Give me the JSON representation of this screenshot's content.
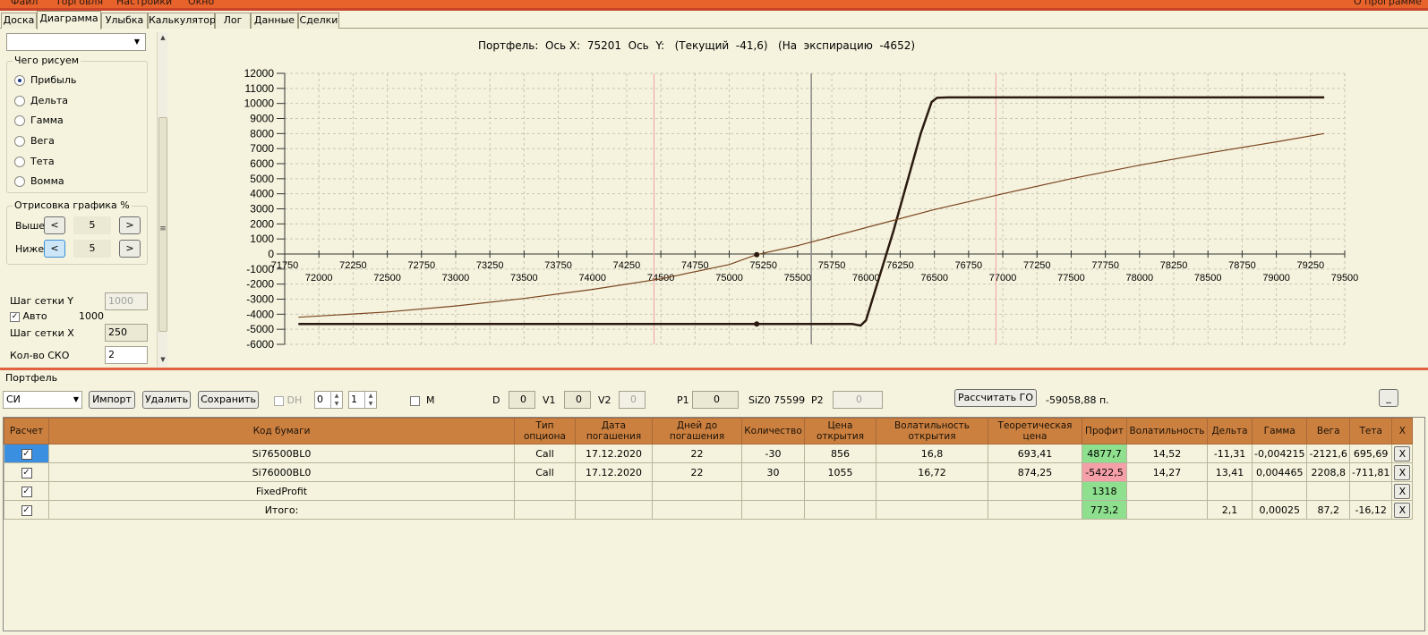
{
  "menubar": {
    "items": [
      "Файл",
      "Торговля",
      "Настройки",
      "Окно"
    ],
    "about": "О программе"
  },
  "tabs": [
    "Доска",
    "Диаграмма",
    "Улыбка",
    "Калькулятор",
    "Лог",
    "Данные",
    "Сделки"
  ],
  "active_tab": "Диаграмма",
  "left": {
    "combo_value": "",
    "what_group": "Чего рисуем",
    "radios": [
      "Прибыль",
      "Дельта",
      "Гамма",
      "Вега",
      "Тета",
      "Вомма"
    ],
    "radio_selected": "Прибыль",
    "draw_group": "Отрисовка графика %",
    "above_label": "Выше",
    "above_value": "5",
    "below_label": "Ниже",
    "below_value": "5",
    "dec": "<",
    "inc": ">",
    "grid_y_label": "Шаг сетки Y",
    "grid_y_value": "1000",
    "auto_label": "Авто",
    "auto_value": "1000",
    "grid_x_label": "Шаг сетки X",
    "grid_x_value": "250",
    "sko_label": "Кол-во СКО",
    "sko_value": "2"
  },
  "chart_title": "Портфель:  Ось X:  75201  Ось  Y:   (Текущий  -41,6)   (На  экспирацию  -4652)",
  "chart_data": {
    "type": "line",
    "x_ticks_upper": [
      71750,
      72250,
      72750,
      73250,
      73750,
      74250,
      74750,
      75250,
      75750,
      76250,
      76750,
      77250,
      77750,
      78250,
      78750,
      79250
    ],
    "x_ticks_lower": [
      72000,
      72500,
      73000,
      73500,
      74000,
      74500,
      75000,
      75500,
      76000,
      76500,
      77000,
      77500,
      78000,
      78500,
      79000,
      79500
    ],
    "y_ticks": [
      12000,
      11000,
      10000,
      9000,
      8000,
      7000,
      6000,
      5000,
      4000,
      3000,
      2000,
      1000,
      0,
      -1000,
      -2000,
      -3000,
      -4000,
      -5000,
      -6000
    ],
    "xlim": [
      71750,
      79500
    ],
    "ylim": [
      -6000,
      12000
    ],
    "grid": true,
    "vertical_markers": {
      "gray": 75600,
      "pink": [
        74450,
        76950
      ]
    },
    "series": [
      {
        "color": "#2a1a10",
        "x": [
          71850,
          72500,
          73000,
          73500,
          74000,
          74500,
          75000,
          75201,
          75500,
          75900,
          75960,
          76000,
          76200,
          76400,
          76480,
          76520,
          76600,
          77000,
          78000,
          79000,
          79350
        ],
        "values": [
          -4650,
          -4650,
          -4650,
          -4650,
          -4650,
          -4650,
          -4650,
          -4652,
          -4650,
          -4650,
          -4750,
          -4400,
          1500,
          8000,
          10100,
          10380,
          10400,
          10400,
          10400,
          10400,
          10400
        ]
      },
      {
        "color": "#7a4420",
        "x": [
          71850,
          72500,
          73000,
          73500,
          74000,
          74500,
          75000,
          75201,
          75500,
          76000,
          76500,
          77000,
          77500,
          78000,
          78500,
          79000,
          79350
        ],
        "values": [
          -4200,
          -3850,
          -3450,
          -2950,
          -2350,
          -1650,
          -700,
          -41.6,
          550,
          1750,
          2950,
          4000,
          5000,
          5900,
          6700,
          7450,
          8000
        ]
      }
    ],
    "markers": [
      {
        "x": 75201,
        "y": -4652
      },
      {
        "x": 75201,
        "y": -41.6
      }
    ]
  },
  "portfolio": {
    "label": "Портфель",
    "combo": "СИ",
    "import": "Импорт",
    "delete": "Удалить",
    "save": "Сохранить",
    "dh_label": "DH",
    "spin1": "0",
    "spin2": "1",
    "m_label": "M",
    "d_label": "D",
    "d_value": "0",
    "v1_label": "V1",
    "v1_value": "0",
    "v2_label": "V2",
    "v2_value": "0",
    "p1_label": "P1",
    "p1_value": "0",
    "siz_text": "SiZ0 75599",
    "p2_label": "P2",
    "p2_value": "0",
    "calc_go": "Рассчитать ГО",
    "go_value": "-59058,88 п.",
    "min_btn": "_"
  },
  "table": {
    "headers": [
      "Расчет",
      "Код бумаги",
      "Тип\nопциона",
      "Дата\nпогашения",
      "Дней до\nпогашения",
      "Количество",
      "Цена\nоткрытия",
      "Волатильность\nоткрытия",
      "Теоретическая\nцена",
      "Профит",
      "Волатильность",
      "Дельта",
      "Гамма",
      "Вега",
      "Тета",
      "X"
    ],
    "rows": [
      {
        "code": "Si76500BL0",
        "type": "Call",
        "date": "17.12.2020",
        "days": "22",
        "qty": "-30",
        "price": "856",
        "vol_open": "16,8",
        "theo": "693,41",
        "profit": "4877,7",
        "profit_color": "green",
        "vol": "14,52",
        "delta": "-11,31",
        "gamma": "-0,004215",
        "vega": "-2121,6",
        "theta": "695,69"
      },
      {
        "code": "Si76000BL0",
        "type": "Call",
        "date": "17.12.2020",
        "days": "22",
        "qty": "30",
        "price": "1055",
        "vol_open": "16,72",
        "theo": "874,25",
        "profit": "-5422,5",
        "profit_color": "pink",
        "vol": "14,27",
        "delta": "13,41",
        "gamma": "0,004465",
        "vega": "2208,8",
        "theta": "-711,81"
      },
      {
        "code": "FixedProfit",
        "type": "",
        "date": "",
        "days": "",
        "qty": "",
        "price": "",
        "vol_open": "",
        "theo": "",
        "profit": "1318",
        "profit_color": "green",
        "vol": "",
        "delta": "",
        "gamma": "",
        "vega": "",
        "theta": ""
      },
      {
        "code": "Итого:",
        "type": "",
        "date": "",
        "days": "",
        "qty": "",
        "price": "",
        "vol_open": "",
        "theo": "",
        "profit": "773,2",
        "profit_color": "green",
        "vol": "",
        "delta": "2,1",
        "gamma": "0,00025",
        "vega": "87,2",
        "theta": "-16,12"
      }
    ],
    "checkmark": "✓",
    "x_label": "X"
  }
}
